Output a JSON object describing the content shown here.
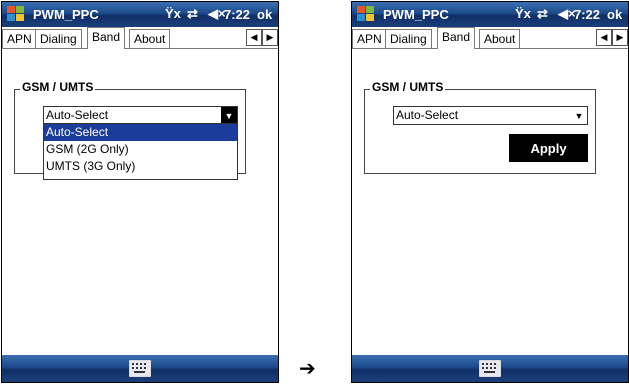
{
  "colors": {
    "title_bar": "#1d4a8a",
    "selection": "#1c3c9a",
    "button": "#000000"
  },
  "left": {
    "title": "PWM_PPC",
    "status": {
      "signal_icon": "signal-off-icon",
      "signal_glyph": "Ÿx",
      "sync_glyph": "⇄",
      "volume_glyph": "◀×",
      "time": "7:22",
      "ok": "ok"
    },
    "tabs": [
      "APN",
      "Dialing",
      "Band",
      "About"
    ],
    "active_tab": "Band",
    "group_label": "GSM / UMTS",
    "select_value": "Auto-Select",
    "options": [
      "Auto-Select",
      "GSM (2G Only)",
      "UMTS (3G Only)"
    ],
    "highlighted_option": "Auto-Select",
    "tab_left_arrow": "◀",
    "tab_right_arrow": "▶",
    "dropdown_arrow": "▼"
  },
  "right": {
    "title": "PWM_PPC",
    "status": {
      "signal_glyph": "Ÿx",
      "sync_glyph": "⇄",
      "volume_glyph": "◀×",
      "time": "7:22",
      "ok": "ok"
    },
    "tabs": [
      "APN",
      "Dialing",
      "Band",
      "About"
    ],
    "active_tab": "Band",
    "group_label": "GSM / UMTS",
    "select_value": "Auto-Select",
    "apply_label": "Apply",
    "tab_left_arrow": "◀",
    "tab_right_arrow": "▶",
    "dropdown_arrow": "▼"
  },
  "transition_arrow": "➔"
}
